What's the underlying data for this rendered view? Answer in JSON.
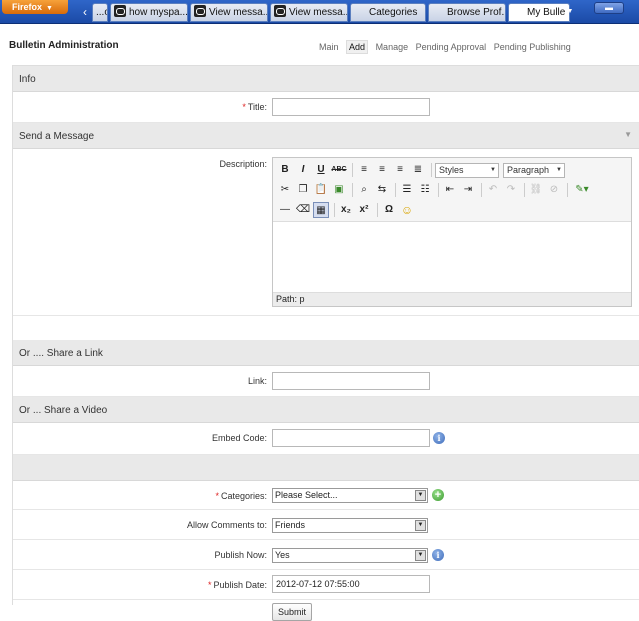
{
  "browser": {
    "menu_label": "Firefox",
    "tabs": [
      {
        "title": "...o..."
      },
      {
        "title": "how myspa..."
      },
      {
        "title": "View messa..."
      },
      {
        "title": "View messa..."
      },
      {
        "title": "Categories"
      },
      {
        "title": "Browse Prof..."
      },
      {
        "title": "My Bulle"
      }
    ]
  },
  "header": {
    "title": "Bulletin Administration",
    "nav": [
      "Main",
      "Add",
      "Manage",
      "Pending Approval",
      "Pending Publishing"
    ],
    "active_nav": "Add"
  },
  "sections": {
    "info": "Info",
    "message": "Send a Message",
    "link": "Or .... Share a Link",
    "video": "Or ... Share a Video"
  },
  "fields": {
    "title_label": "Title:",
    "title_value": "",
    "description_label": "Description:",
    "link_label": "Link:",
    "link_value": "",
    "embed_label": "Embed Code:",
    "embed_value": "",
    "categories_label": "Categories:",
    "categories_value": "Please Select...",
    "comments_label": "Allow Comments to:",
    "comments_value": "Friends",
    "publish_label": "Publish Now:",
    "publish_value": "Yes",
    "publish_date_label": "Publish Date:",
    "publish_date_value": "2012-07-12 07:55:00",
    "required_marker": "*"
  },
  "editor": {
    "styles_label": "Styles",
    "format_label": "Paragraph",
    "path_label": "Path: p"
  },
  "submit_label": "Submit"
}
